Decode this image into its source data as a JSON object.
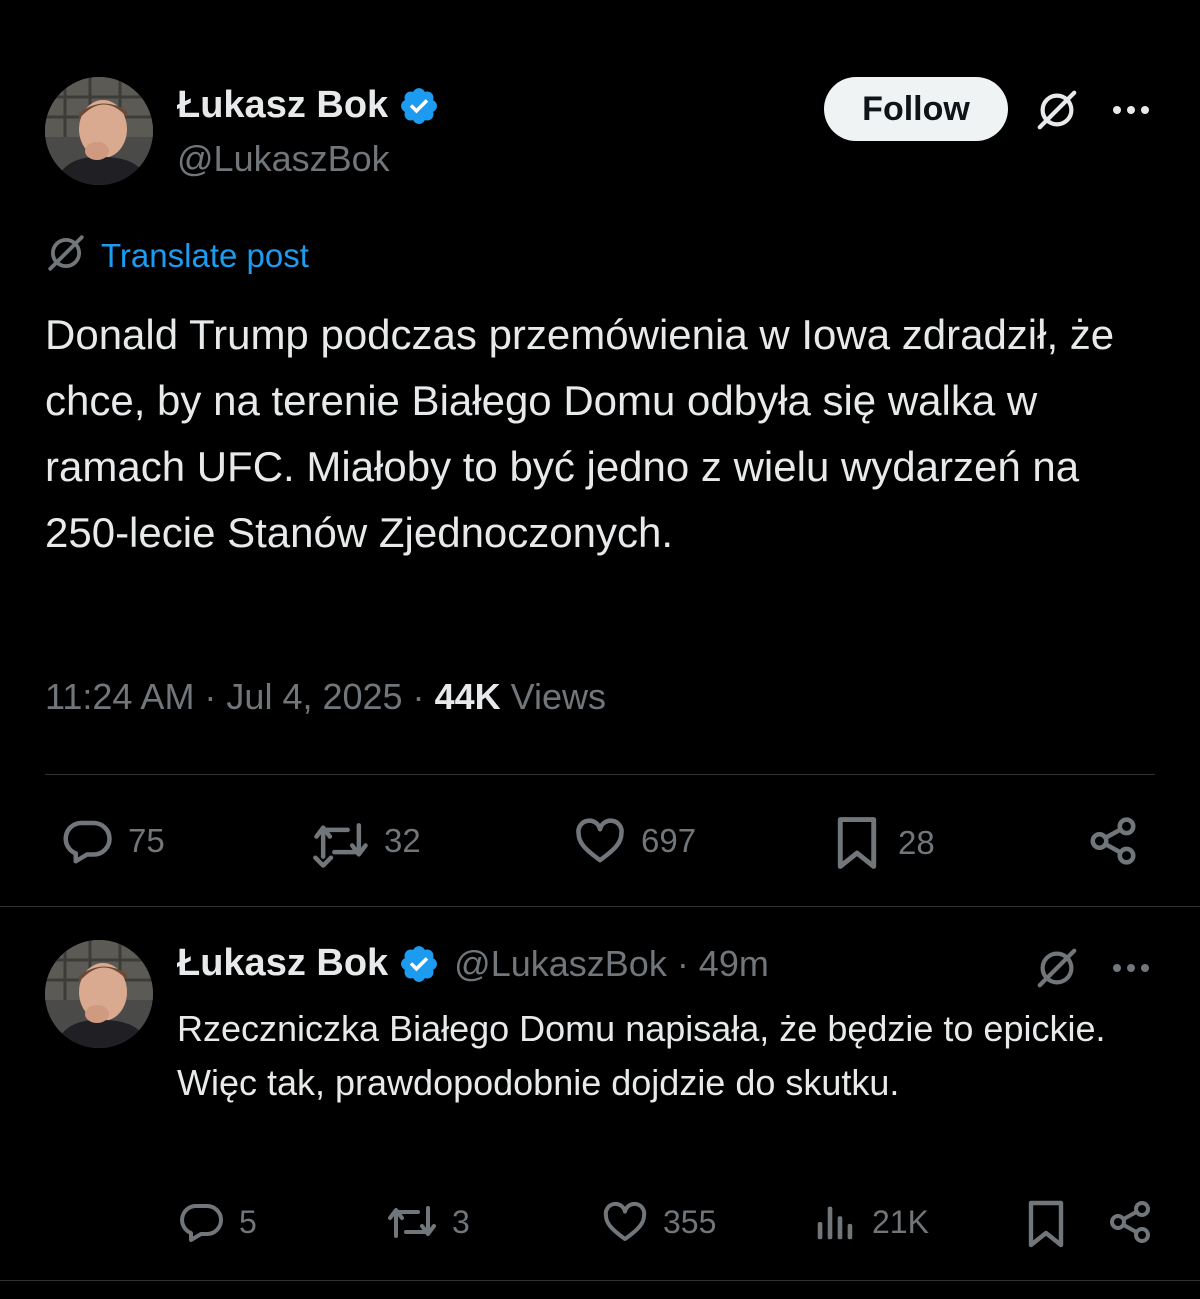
{
  "post": {
    "author": {
      "display_name": "Łukasz Bok",
      "handle": "@LukaszBok",
      "verified": true
    },
    "follow_label": "Follow",
    "translate_label": "Translate post",
    "text": "Donald Trump podczas przemówienia w Iowa zdradził, że chce, by na terenie Białego Domu odbyła się walka w ramach UFC. Miałoby to być jedno z wielu wydarzeń na 250-lecie Stanów Zjednoczonych.",
    "timestamp": "11:24 AM · Jul 4, 2025 · ",
    "views_count": "44K",
    "views_label": " Views",
    "actions": {
      "replies": "75",
      "reposts": "32",
      "likes": "697",
      "bookmarks": "28"
    }
  },
  "reply": {
    "author": {
      "display_name": "Łukasz Bok",
      "handle_time": "@LukaszBok · 49m",
      "verified": true
    },
    "text": "Rzeczniczka Białego Domu napisała, że będzie to epickie. Więc tak, prawdopodobnie dojdzie do skutku.",
    "actions": {
      "replies": "5",
      "reposts": "3",
      "likes": "355",
      "views": "21K"
    }
  },
  "colors": {
    "background": "#000000",
    "text_primary": "#e7e9ea",
    "text_secondary": "#71767b",
    "accent": "#1d9bf0",
    "divider": "#2f3336",
    "follow_bg": "#eff3f4"
  },
  "icons": [
    "verified-badge-icon",
    "grok-icon",
    "more-icon",
    "translate-icon",
    "reply-icon",
    "repost-icon",
    "like-icon",
    "bookmark-icon",
    "share-icon",
    "views-icon"
  ]
}
